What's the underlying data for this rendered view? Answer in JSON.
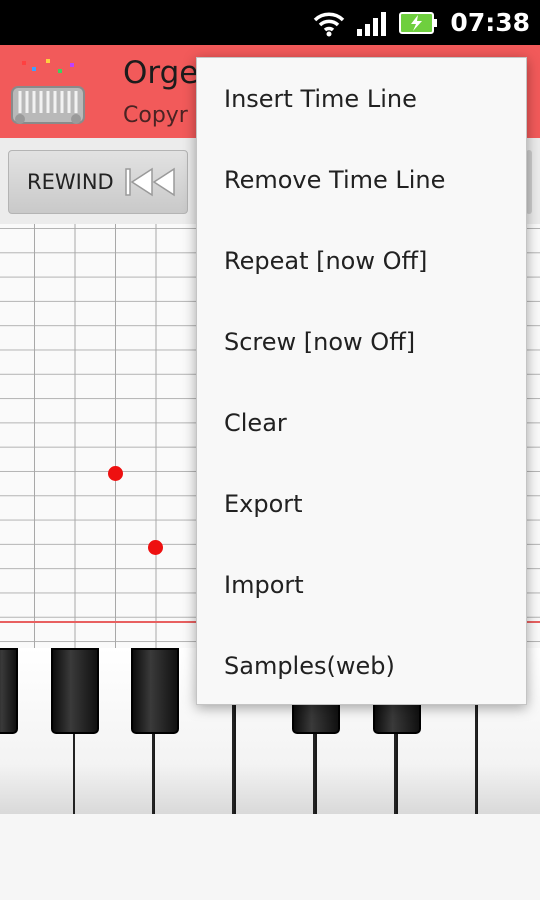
{
  "status_bar": {
    "time": "07:38",
    "icons": [
      "wifi-icon",
      "signal-icon",
      "battery-charging-icon"
    ]
  },
  "app": {
    "title": "Orge",
    "subtitle": "Copyr",
    "header_color": "#f25a5a"
  },
  "toolbar": {
    "rewind_label": "REWIND",
    "rewind_icon": "rewind-icon"
  },
  "roll": {
    "note_color": "#ee1010",
    "playline_color": "#e86060"
  },
  "menu": {
    "items": [
      "Insert Time Line",
      "Remove Time Line",
      "Repeat [now Off]",
      "Screw [now Off]",
      "Clear",
      "Export",
      "Import",
      "Samples(web)"
    ]
  }
}
